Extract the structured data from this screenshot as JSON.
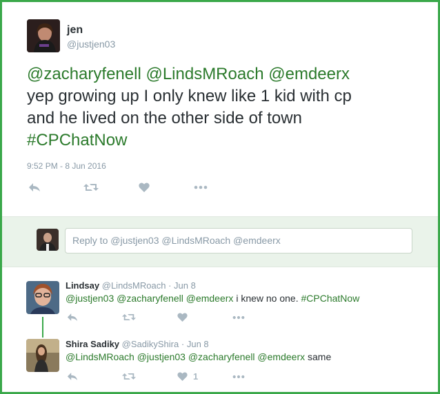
{
  "colors": {
    "border": "#3aa84a",
    "link": "#2b7a2b",
    "muted": "#8899a6",
    "action_icon": "#aab8c2",
    "reply_band": "#eaf3ea"
  },
  "main_tweet": {
    "name": "jen",
    "handle": "@justjen03",
    "mentions": [
      "@zacharyfenell",
      "@LindsMRoach",
      "@emdeerx"
    ],
    "text_line1_rest": "yep growing up I only knew like 1 kid with cp",
    "text_line2": "and he lived on the other side of town",
    "hashtag": "#CPChatNow",
    "timestamp": "9:52 PM - 8 Jun 2016",
    "actions": {
      "reply": "reply-icon",
      "retweet": "retweet-icon",
      "like": "heart-icon",
      "more": "more-icon"
    }
  },
  "reply_box": {
    "placeholder": "Reply to @justjen03 @LindsMRoach @emdeerx"
  },
  "replies": [
    {
      "name": "Lindsay",
      "handle": "@LindsMRoach",
      "date": "Jun 8",
      "mentions": "@justjen03 @zacharyfenell @emdeerx",
      "text": "i knew no one.",
      "hashtag": "#CPChatNow",
      "like_count": ""
    },
    {
      "name": "Shira Sadiky",
      "handle": "@SadikyShira",
      "date": "Jun 8",
      "mentions": "@LindsMRoach @justjen03 @zacharyfenell @emdeerx",
      "text": "same",
      "hashtag": "",
      "like_count": "1"
    }
  ]
}
